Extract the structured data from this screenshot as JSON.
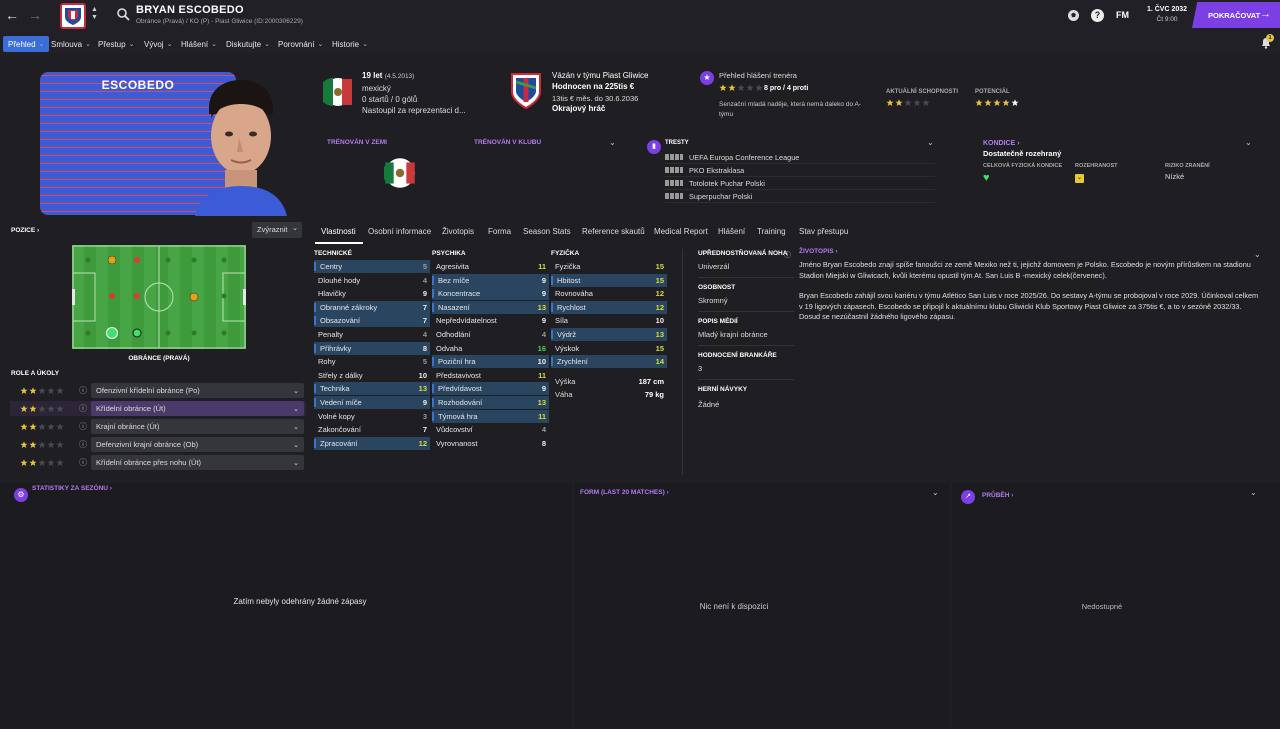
{
  "topbar": {
    "player_name": "BRYAN ESCOBEDO",
    "player_sub": "Obránce (Pravá) / KO (P) - Piast Gliwice (ID:2000306229)",
    "fm_label": "FM",
    "date": "1. ČVC 2032",
    "time": "Čt 9:00",
    "continue_label": "POKRAČOVAT"
  },
  "subnav": [
    {
      "label": "Přehled"
    },
    {
      "label": "Smlouva"
    },
    {
      "label": "Přestup"
    },
    {
      "label": "Vývoj"
    },
    {
      "label": "Hlášení"
    },
    {
      "label": "Diskutujte"
    },
    {
      "label": "Porovnání"
    },
    {
      "label": "Historie"
    }
  ],
  "notification_count": "1",
  "card": {
    "shirt_name": "ESCOBEDO",
    "age_label": "19 let",
    "dob": "(4.5.2013)",
    "nationality": "mexický",
    "caps": "0 startů / 0 gólů",
    "intl_note": "Nastoupil za reprezentaci d...",
    "contract_club": "Vázán v týmu Piast Gliwice",
    "value": "Hodnocen na 225tis €",
    "wage": "13tis € měs. do 30.6.2036",
    "squad_status": "Okrajový hráč",
    "scout_title": "Přehled hlášení trenéra",
    "scout_pros": "8 pro / 4 proti",
    "scout_text": "Senzační mladá naděje, která nemá daleko do A-týmu",
    "current_ability_label": "AKTUÁLNÍ SCHOPNOSTI",
    "current_ability_stars": 2,
    "potential_label": "POTENCIÁL",
    "potential_stars": 4.5,
    "scout_stars": 2,
    "trained_nation_label": "TRÉNOVÁN V ZEMI",
    "trained_club_label": "TRÉNOVÁN V KLUBU",
    "bans_label": "TRESTY",
    "bans": [
      "UEFA Europa Conference League",
      "PKO Ekstraklasa",
      "Totolotek Puchar Polski",
      "Superpuchar Polski"
    ],
    "fitness_label": "KONDICE",
    "fitness_value": "Dostatečně rozehraný",
    "overall_cond_label": "CELKOVÁ FYZICKÁ KONDICE",
    "match_sharp_label": "ROZEHRANOST",
    "injury_risk_label": "RIZIKO ZRANĚNÍ",
    "injury_risk_value": "Nízké"
  },
  "position_panel": {
    "title": "POZICE",
    "highlight_label": "Zvýraznit",
    "position_name": "OBRÁNCE (PRAVÁ)",
    "roles_title": "ROLE A ÚKOLY",
    "roles": [
      {
        "label": "Ofenzivní křídelní obránce (Po)",
        "stars": 2,
        "selected": false
      },
      {
        "label": "Křídelní obránce (Út)",
        "stars": 2,
        "selected": true
      },
      {
        "label": "Krajní obránce (Út)",
        "stars": 2,
        "selected": false
      },
      {
        "label": "Defenzivní krajní obránce (Ob)",
        "stars": 2,
        "selected": false
      },
      {
        "label": "Křídelní obránce přes nohu (Út)",
        "stars": 2,
        "selected": false
      }
    ]
  },
  "tabs": [
    "Vlastnosti",
    "Osobní informace",
    "Životopis",
    "Forma",
    "Season Stats",
    "Reference skautů",
    "Medical Report",
    "Hlášení",
    "Training",
    "Stav přestupu"
  ],
  "attributes": {
    "technical_title": "TECHNICKÉ",
    "mental_title": "PSYCHIKA",
    "physical_title": "FYZIČKA",
    "technical": [
      {
        "name": "Centry",
        "value": "5",
        "hl": true,
        "c": "grey"
      },
      {
        "name": "Dlouhé hody",
        "value": "4",
        "hl": false,
        "c": "grey"
      },
      {
        "name": "Hlavičky",
        "value": "9",
        "hl": false,
        "c": "white"
      },
      {
        "name": "Obranné zákroky",
        "value": "7",
        "hl": true,
        "c": "white"
      },
      {
        "name": "Obsazování",
        "value": "7",
        "hl": true,
        "c": "white"
      },
      {
        "name": "Penalty",
        "value": "4",
        "hl": false,
        "c": "grey"
      },
      {
        "name": "Přihrávky",
        "value": "8",
        "hl": true,
        "c": "white"
      },
      {
        "name": "Rohy",
        "value": "5",
        "hl": false,
        "c": "grey"
      },
      {
        "name": "Střely z dálky",
        "value": "10",
        "hl": false,
        "c": "white"
      },
      {
        "name": "Technika",
        "value": "13",
        "hl": true,
        "c": "yellow"
      },
      {
        "name": "Vedení míče",
        "value": "9",
        "hl": true,
        "c": "white"
      },
      {
        "name": "Volné kopy",
        "value": "3",
        "hl": false,
        "c": "grey"
      },
      {
        "name": "Zakončování",
        "value": "7",
        "hl": false,
        "c": "white"
      },
      {
        "name": "Zpracování",
        "value": "12",
        "hl": true,
        "c": "yellow"
      }
    ],
    "mental": [
      {
        "name": "Agresivita",
        "value": "11",
        "hl": false,
        "c": "yellow"
      },
      {
        "name": "Bez míče",
        "value": "9",
        "hl": true,
        "c": "white"
      },
      {
        "name": "Koncentrace",
        "value": "9",
        "hl": true,
        "c": "white"
      },
      {
        "name": "Nasazení",
        "value": "13",
        "hl": true,
        "c": "yellow"
      },
      {
        "name": "Nepředvídatelnost",
        "value": "9",
        "hl": false,
        "c": "white"
      },
      {
        "name": "Odhodlání",
        "value": "4",
        "hl": false,
        "c": "grey"
      },
      {
        "name": "Odvaha",
        "value": "16",
        "hl": false,
        "c": "green"
      },
      {
        "name": "Poziční hra",
        "value": "10",
        "hl": true,
        "c": "white"
      },
      {
        "name": "Představivost",
        "value": "11",
        "hl": false,
        "c": "yellow"
      },
      {
        "name": "Předvídavost",
        "value": "9",
        "hl": true,
        "c": "white"
      },
      {
        "name": "Rozhodování",
        "value": "13",
        "hl": true,
        "c": "yellow"
      },
      {
        "name": "Týmová hra",
        "value": "11",
        "hl": true,
        "c": "yellow"
      },
      {
        "name": "Vůdcovství",
        "value": "4",
        "hl": false,
        "c": "grey"
      },
      {
        "name": "Vyrovnanost",
        "value": "8",
        "hl": false,
        "c": "white"
      }
    ],
    "physical": [
      {
        "name": "Fyzička",
        "value": "15",
        "hl": false,
        "c": "yellow"
      },
      {
        "name": "Hbitost",
        "value": "15",
        "hl": true,
        "c": "yellow"
      },
      {
        "name": "Rovnováha",
        "value": "12",
        "hl": false,
        "c": "yellow"
      },
      {
        "name": "Rychlost",
        "value": "12",
        "hl": true,
        "c": "yellow"
      },
      {
        "name": "Síla",
        "value": "10",
        "hl": false,
        "c": "white"
      },
      {
        "name": "Výdrž",
        "value": "13",
        "hl": true,
        "c": "yellow"
      },
      {
        "name": "Výskok",
        "value": "15",
        "hl": false,
        "c": "yellow"
      },
      {
        "name": "Zrychlení",
        "value": "14",
        "hl": true,
        "c": "yellow"
      }
    ],
    "height_label": "Výška",
    "height_value": "187 cm",
    "weight_label": "Váha",
    "weight_value": "79 kg"
  },
  "info": {
    "foot_label": "UPŘEDNOSTŇOVANÁ NOHA",
    "foot_value": "Univerzál",
    "personality_label": "OSOBNOST",
    "personality_value": "Skromný",
    "media_label": "POPIS MÉDIÍ",
    "media_value": "Mladý krajní obránce",
    "gk_label": "HODNOCENÍ BRANKÁŘE",
    "gk_value": "3",
    "habits_label": "HERNÍ NÁVYKY",
    "habits_value": "Žádné"
  },
  "bio": {
    "title": "ŽIVOTOPIS",
    "p1": "Jméno Bryan Escobedo znají spíše fanoušci ze země Mexiko než ti, jejichž domovem je Polsko. Escobedo je novým přírůstkem na stadionu Stadion Miejski w Gliwicach, kvůli kterému opustil tým At. San Luis B -mexický celek(červenec).",
    "p2": "Bryan Escobedo zahájil svou kariéru v týmu Atlético San Luis v roce 2025/26. Do sestavy A-týmu se probojoval v roce 2029. Účinkoval celkem v 19 ligových zápasech. Escobedo se připojil k aktuálnímu klubu Gliwicki Klub Sportowy Piast Gliwice za 375tis €, a to v sezóně 2032/33. Dosud se nezúčastnil žádného ligového zápasu."
  },
  "bottom": {
    "stats_title": "STATISTIKY ZA SEZÓNU",
    "stats_empty": "Zatím nebyly odehrány žádné zápasy",
    "form_title": "FORM (LAST 20 MATCHES)",
    "form_empty": "Nic není k dispozici",
    "progress_title": "PRŮBĚH",
    "progress_empty": "Nedostupné"
  },
  "colors": {
    "accent": "#7b3fe4",
    "nav_active": "#3a6dd8",
    "pitch": "#3f9a3c",
    "highlight_row": "#2a4560",
    "purple_label": "#b57bf0"
  }
}
